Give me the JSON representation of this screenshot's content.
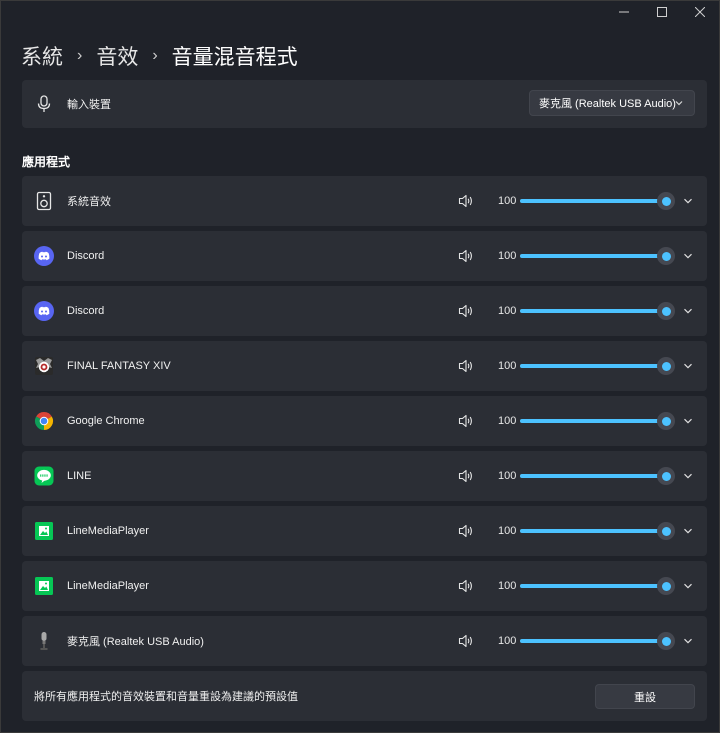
{
  "breadcrumb": [
    "系統",
    "音效",
    "音量混音程式"
  ],
  "input_device": {
    "label": "輸入裝置",
    "selected": "麥克風 (Realtek USB Audio)"
  },
  "apps_section_title": "應用程式",
  "apps": [
    {
      "name": "系統音效",
      "icon": "speaker-icon",
      "volume": 100
    },
    {
      "name": "Discord",
      "icon": "discord-icon",
      "volume": 100
    },
    {
      "name": "Discord",
      "icon": "discord-icon",
      "volume": 100
    },
    {
      "name": "FINAL FANTASY XIV",
      "icon": "ffxiv-icon",
      "volume": 100
    },
    {
      "name": "Google Chrome",
      "icon": "chrome-icon",
      "volume": 100
    },
    {
      "name": "LINE",
      "icon": "line-icon",
      "volume": 100
    },
    {
      "name": "LineMediaPlayer",
      "icon": "line-media-player-icon",
      "volume": 100
    },
    {
      "name": "LineMediaPlayer",
      "icon": "line-media-player-icon",
      "volume": 100
    },
    {
      "name": "麥克風 (Realtek USB Audio)",
      "icon": "microphone-icon",
      "volume": 100
    }
  ],
  "reset": {
    "text": "將所有應用程式的音效裝置和音量重設為建議的預設值",
    "button_label": "重設"
  },
  "colors": {
    "accent": "#4cc2ff",
    "card": "#2b2e35",
    "background": "#1f2229",
    "discord": "#5865f2",
    "line": "#06c755",
    "chrome_red": "#db4437",
    "chrome_yellow": "#f4b400",
    "chrome_green": "#0f9d58",
    "chrome_blue": "#4285f4"
  }
}
